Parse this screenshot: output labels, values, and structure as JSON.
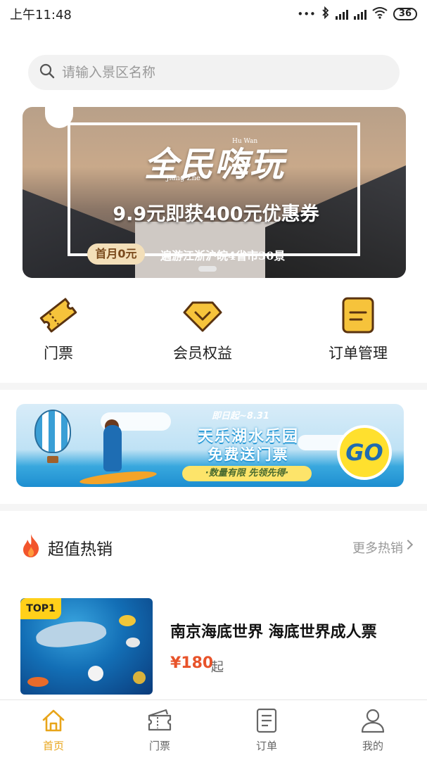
{
  "status_bar": {
    "time": "上午11:48",
    "dots": "•••",
    "battery": "36"
  },
  "search": {
    "placeholder": "请输入景区名称"
  },
  "hero_banner": {
    "title": "全民嗨玩",
    "pinyin_top": "Hu Wan",
    "pinyin_bottom": "· Jiang Zhe ·",
    "offer": "9.9元即获400元优惠券",
    "badge": "首月0元",
    "subtitle": "遍游江浙沪皖4省市30景"
  },
  "categories": [
    {
      "label": "门票",
      "icon": "ticket-icon"
    },
    {
      "label": "会员权益",
      "icon": "diamond-icon"
    },
    {
      "label": "订单管理",
      "icon": "order-icon"
    }
  ],
  "promo_banner": {
    "date": "即日起~8.31",
    "line1": "天乐湖水乐园",
    "line2": "免费送门票",
    "note": "·数量有限 先领先得·",
    "go": "GO"
  },
  "hot_section": {
    "title": "超值热销",
    "more": "更多热销",
    "products": [
      {
        "tag": "TOP1",
        "name": "南京海底世界 海底世界成人票",
        "price": "¥180",
        "suffix": "起"
      }
    ]
  },
  "tab_bar": {
    "tabs": [
      {
        "label": "首页",
        "icon": "home-icon",
        "active": true
      },
      {
        "label": "门票",
        "icon": "ticket-icon",
        "active": false
      },
      {
        "label": "订单",
        "icon": "order-icon",
        "active": false
      },
      {
        "label": "我的",
        "icon": "user-icon",
        "active": false
      }
    ]
  },
  "colors": {
    "accent": "#e8a51a",
    "icon_yellow": "#f6c33b",
    "icon_brown": "#5a3310",
    "price_red": "#e8532a"
  }
}
